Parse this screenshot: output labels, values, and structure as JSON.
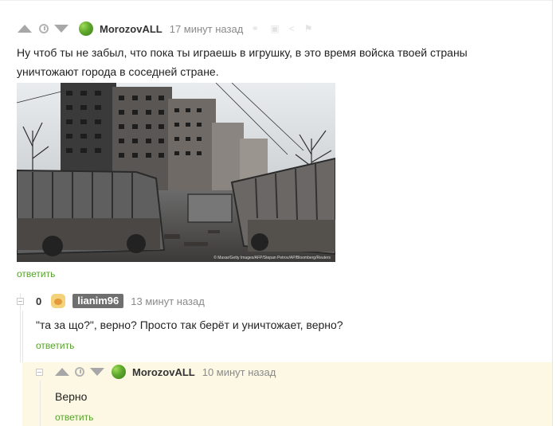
{
  "comment1": {
    "username": "MorozovALL",
    "time": "17 минут назад",
    "text_line1": "Ну чтоб ты не забыл, что пока ты играешь в игрушку, в это время войска твоей страны",
    "text_line2": "уничтожают города в соседней стране.",
    "image_caption": "© Maxar/Getty Images/AFP/Stepan Petrov/AP/Bloomberg/Reuters",
    "reply_label": "ответить"
  },
  "comment2": {
    "score": "0",
    "username": "lianim96",
    "time": "13 минут назад",
    "text": "\"та за що?\", верно? Просто так берёт и  уничтожает, верно?",
    "reply_label": "ответить"
  },
  "comment3": {
    "username": "MorozovALL",
    "time": "10 минут назад",
    "text": "Верно",
    "reply_label": "ответить"
  },
  "colors": {
    "accent": "#59a02f",
    "highlight_bg": "#fdf8e4",
    "username_badge": "#6f6f6f"
  },
  "icons": [
    "upvote-icon",
    "clock-icon",
    "downvote-icon",
    "avatar-icon",
    "link-icon",
    "save-icon",
    "share-icon",
    "flag-icon",
    "collapse-icon"
  ]
}
